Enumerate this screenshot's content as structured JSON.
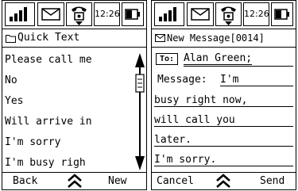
{
  "status": {
    "time": "12:26"
  },
  "left": {
    "title": "Quick Text",
    "items": [
      "Please call me",
      "No",
      "Yes",
      "Will arrive in",
      "I'm sorry",
      "I'm busy righ"
    ],
    "softkeys": {
      "left": "Back",
      "right": "New"
    }
  },
  "right": {
    "title": "New Message[0014]",
    "to_label": "To:",
    "to_value": "Alan Green;",
    "message_label": "Message:",
    "message_lines": [
      "I'm",
      "busy right now,",
      "will call you",
      "later.",
      "I'm sorry."
    ],
    "softkeys": {
      "left": "Cancel",
      "right": "Send"
    }
  }
}
